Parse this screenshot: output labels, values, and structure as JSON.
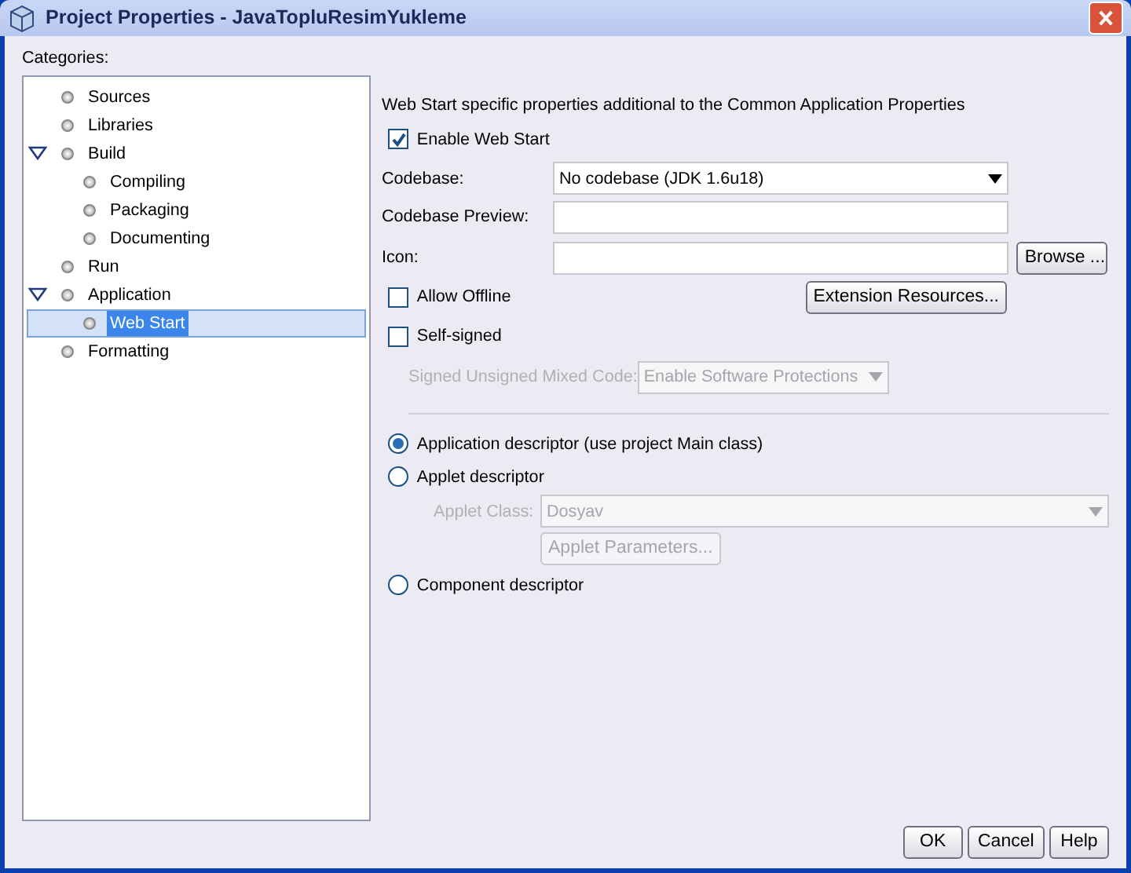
{
  "window": {
    "title": "Project Properties - JavaTopluResimYukleme"
  },
  "categories": {
    "label": "Categories:",
    "items": [
      {
        "label": "Sources",
        "selected": false
      },
      {
        "label": "Libraries",
        "selected": false
      },
      {
        "label": "Build",
        "selected": false,
        "expanded": true,
        "children": [
          {
            "label": "Compiling",
            "selected": false
          },
          {
            "label": "Packaging",
            "selected": false
          },
          {
            "label": "Documenting",
            "selected": false
          }
        ]
      },
      {
        "label": "Run",
        "selected": false
      },
      {
        "label": "Application",
        "selected": false,
        "expanded": true,
        "children": [
          {
            "label": "Web Start",
            "selected": true
          }
        ]
      },
      {
        "label": "Formatting",
        "selected": false
      }
    ]
  },
  "panel": {
    "description": "Web Start specific properties additional to the Common Application Properties",
    "enable_web_start": {
      "label": "Enable Web Start",
      "checked": true
    },
    "fields": [
      {
        "kind": "select",
        "label": "Codebase:",
        "value": "No codebase (JDK 1.6u18)"
      },
      {
        "kind": "text",
        "label": "Codebase Preview:"
      },
      {
        "kind": "text",
        "label": "Icon:",
        "button": "Browse ..."
      }
    ],
    "allow_offline": {
      "label": "Allow Offline",
      "checked": false
    },
    "extension_button": "Extension Resources...",
    "self_signed": {
      "label": "Self-signed",
      "checked": false
    },
    "mixed_code": {
      "label": "Signed Unsigned Mixed Code:",
      "value": "Enable Software Protections",
      "disabled": true
    },
    "descriptors": [
      {
        "label": "Application descriptor (use project Main class)",
        "selected": true
      },
      {
        "label": "Applet descriptor",
        "selected": false,
        "applet_class": {
          "label": "Applet Class:",
          "value": "Dosyav",
          "disabled": true
        },
        "parameters_button": {
          "label": "Applet Parameters...",
          "disabled": true
        }
      },
      {
        "label": "Component descriptor",
        "selected": false
      }
    ]
  },
  "buttons": [
    "OK",
    "Cancel",
    "Help"
  ]
}
